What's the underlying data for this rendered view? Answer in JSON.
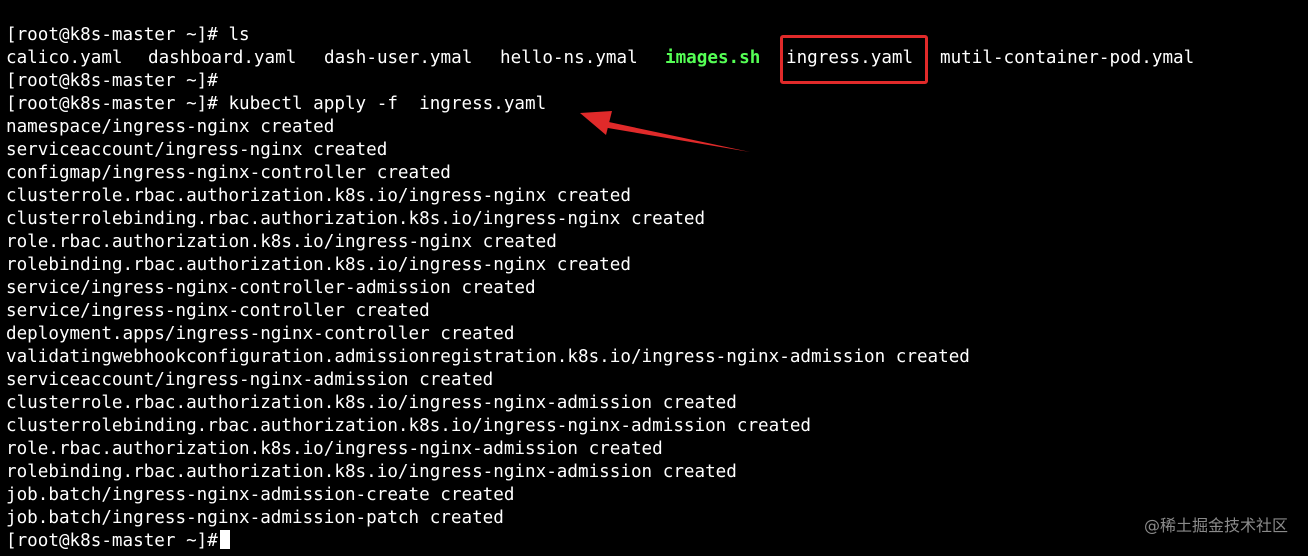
{
  "terminal": {
    "prompt": "[root@k8s-master ~]#",
    "ls_command": "[root@k8s-master ~]# ls",
    "ls_files": [
      {
        "name": "calico.yaml",
        "kind": "file"
      },
      {
        "name": "dashboard.yaml",
        "kind": "file"
      },
      {
        "name": "dash-user.ymal",
        "kind": "file"
      },
      {
        "name": "hello-ns.ymal",
        "kind": "file"
      },
      {
        "name": "images.sh",
        "kind": "executable"
      },
      {
        "name": "ingress.yaml",
        "kind": "file",
        "highlighted": true
      },
      {
        "name": "mutil-container-pod.ymal",
        "kind": "file"
      }
    ],
    "apply_command": "[root@k8s-master ~]# kubectl apply -f  ingress.yaml",
    "output": [
      "namespace/ingress-nginx created",
      "serviceaccount/ingress-nginx created",
      "configmap/ingress-nginx-controller created",
      "clusterrole.rbac.authorization.k8s.io/ingress-nginx created",
      "clusterrolebinding.rbac.authorization.k8s.io/ingress-nginx created",
      "role.rbac.authorization.k8s.io/ingress-nginx created",
      "rolebinding.rbac.authorization.k8s.io/ingress-nginx created",
      "service/ingress-nginx-controller-admission created",
      "service/ingress-nginx-controller created",
      "deployment.apps/ingress-nginx-controller created",
      "validatingwebhookconfiguration.admissionregistration.k8s.io/ingress-nginx-admission created",
      "serviceaccount/ingress-nginx-admission created",
      "clusterrole.rbac.authorization.k8s.io/ingress-nginx-admission created",
      "clusterrolebinding.rbac.authorization.k8s.io/ingress-nginx-admission created",
      "role.rbac.authorization.k8s.io/ingress-nginx-admission created",
      "rolebinding.rbac.authorization.k8s.io/ingress-nginx-admission created",
      "job.batch/ingress-nginx-admission-create created",
      "job.batch/ingress-nginx-admission-patch created"
    ]
  },
  "annotations": {
    "highlight_color": "#e02a2a",
    "arrow_color": "#e02a2a"
  },
  "watermark": {
    "text": "@稀土掘金技术社区"
  },
  "colors": {
    "background": "#000000",
    "foreground": "#ffffff",
    "executable": "#55ff55"
  }
}
